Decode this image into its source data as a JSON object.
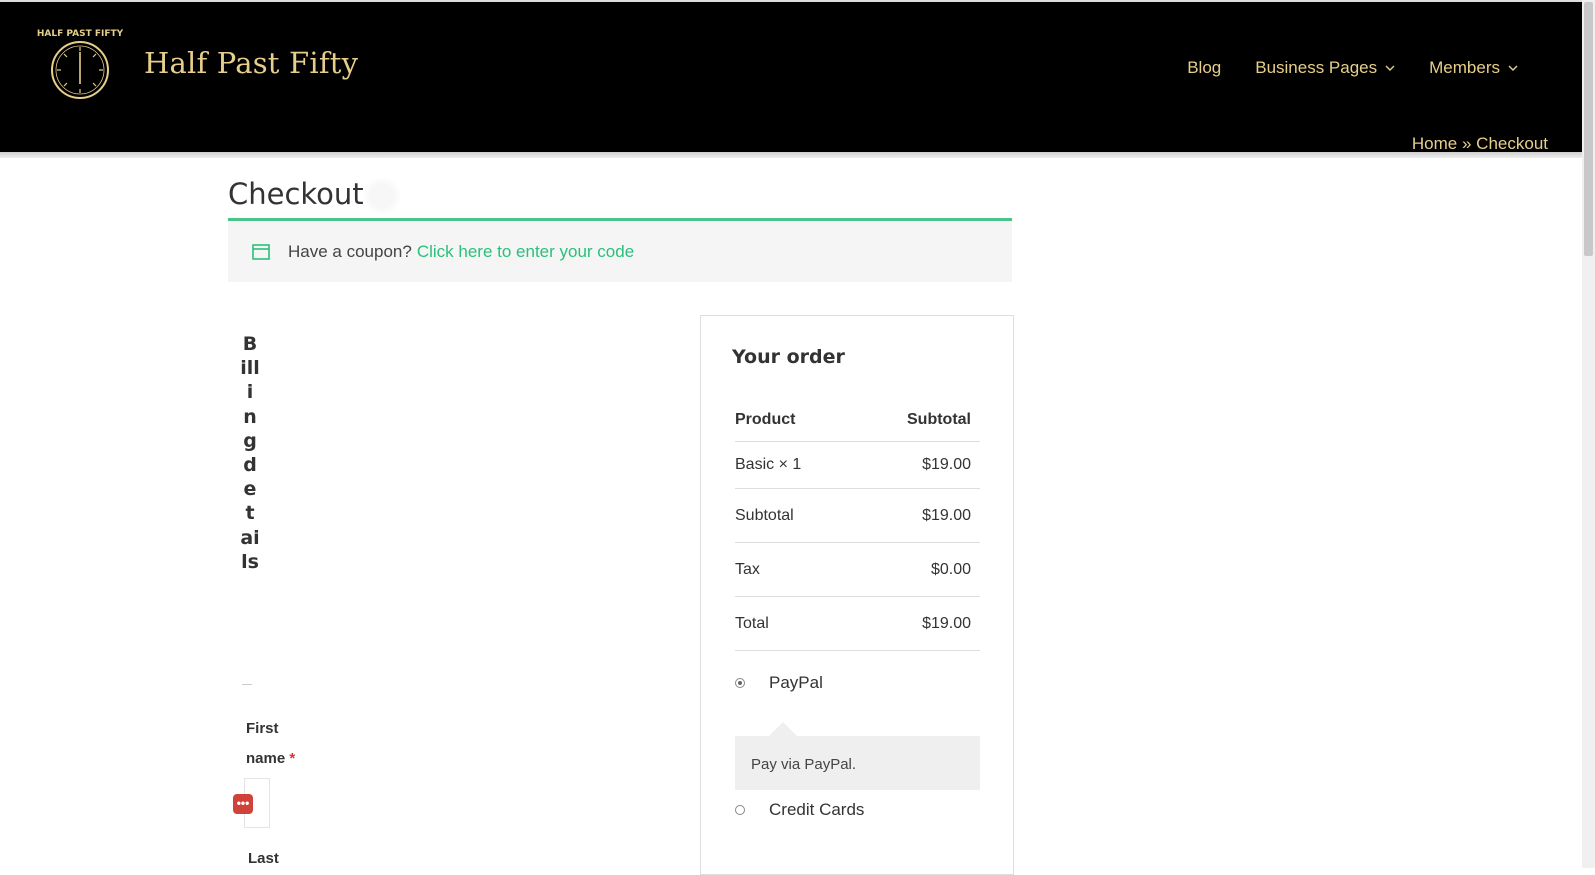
{
  "header": {
    "logo_text": "HALF PAST FIFTY",
    "site_title": "Half Past Fifty",
    "nav": [
      {
        "label": "Blog"
      },
      {
        "label": "Business Pages"
      },
      {
        "label": "Members"
      }
    ],
    "breadcrumb": {
      "home": "Home",
      "sep": "»",
      "current": "Checkout"
    }
  },
  "page": {
    "title": "Checkout"
  },
  "coupon": {
    "text": "Have a coupon?",
    "link": "Click here to enter your code"
  },
  "billing": {
    "heading": "Billing details",
    "first_name_label_1": "First",
    "first_name_label_2": "name",
    "required_mark": "*",
    "last_name_label": "Last",
    "password_icon": "•••"
  },
  "order": {
    "title": "Your order",
    "head": {
      "product": "Product",
      "subtotal": "Subtotal"
    },
    "item": {
      "name": "Basic × 1",
      "price": "$19.00"
    },
    "subtotal": {
      "label": "Subtotal",
      "value": "$19.00"
    },
    "tax": {
      "label": "Tax",
      "value": "$0.00"
    },
    "total": {
      "label": "Total",
      "value": "$19.00"
    },
    "payment": {
      "paypal": "PayPal",
      "paypal_desc": "Pay via PayPal.",
      "cards": "Credit Cards"
    }
  },
  "colors": {
    "header_bg": "#000000",
    "gold": "#e6cf8a",
    "accent_green": "#2bbf7a",
    "required": "#dd3333"
  }
}
